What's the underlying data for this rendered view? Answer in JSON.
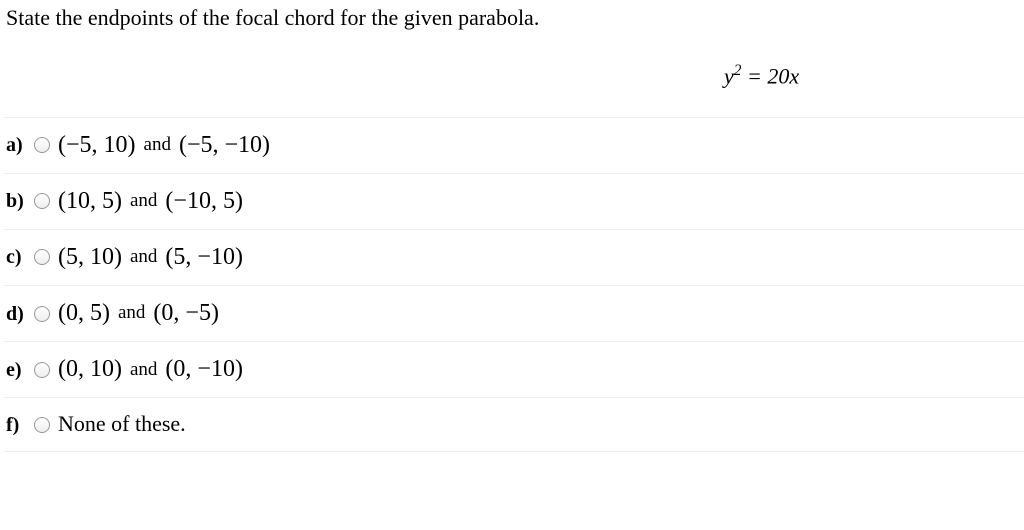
{
  "question": "State the endpoints of the focal chord for the given parabola.",
  "equation": {
    "lhs": "y",
    "exp": "2",
    "mid": " = 20",
    "rhs": "x"
  },
  "and": "and",
  "options": [
    {
      "label": "a)",
      "p1": "(−5, 10)",
      "p2": "(−5, −10)"
    },
    {
      "label": "b)",
      "p1": "(10, 5)",
      "p2": "(−10, 5)"
    },
    {
      "label": "c)",
      "p1": "(5, 10)",
      "p2": "(5, −10)"
    },
    {
      "label": "d)",
      "p1": "(0, 5)",
      "p2": "(0, −5)"
    },
    {
      "label": "e)",
      "p1": "(0, 10)",
      "p2": "(0, −10)"
    },
    {
      "label": "f)",
      "none": "None of these."
    }
  ]
}
